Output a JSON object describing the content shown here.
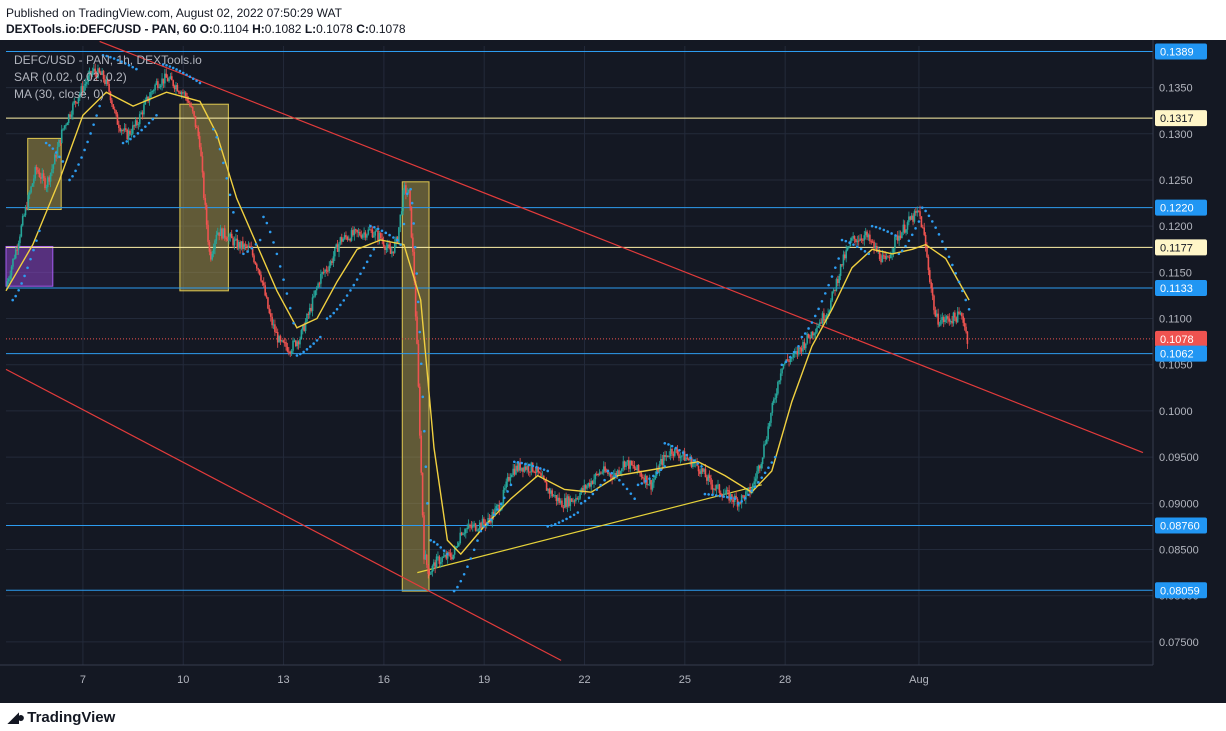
{
  "header": {
    "published": "Published on TradingView.com, August 02, 2022 07:50:29 WAT",
    "symbol": "DEXTools.io:DEFC/USD - PAN, 60",
    "o_label": "O:",
    "o": "0.1104",
    "h_label": "H:",
    "h": "0.1082",
    "l_label": "L:",
    "l": "0.1078",
    "c_label": "C:",
    "c": "0.1078"
  },
  "legend": {
    "title": "DEFC/USD - PAN, 1h, DEXTools.io",
    "sar": "SAR (0.02, 0.02, 0.2)",
    "ma": "MA (30, close, 0)"
  },
  "footer": {
    "logo": "TradingView"
  },
  "colors": {
    "background": "#141823",
    "grid": "#232a3a",
    "axis_text": "#b2b5be",
    "up": "#26a69a",
    "down": "#ef5350",
    "sar": "#2d9cf0",
    "ma": "#f0d040",
    "blue_level": "#2d9cf0",
    "yellow_level": "#fff2a8",
    "trend_red": "#e23b3b",
    "trend_yellow": "#e6d23a"
  },
  "chart_data": {
    "type": "candlestick",
    "ylim": [
      0.0725,
      0.1395
    ],
    "xlim": [
      4.7,
      39.0
    ],
    "y_ticks": [
      "0.07500",
      "0.08000",
      "0.08500",
      "0.09000",
      "0.09500",
      "0.1000",
      "0.1050",
      "0.1100",
      "0.1150",
      "0.1200",
      "0.1250",
      "0.1300",
      "0.1350"
    ],
    "x_ticks": [
      {
        "x": 7,
        "label": "7"
      },
      {
        "x": 10,
        "label": "10"
      },
      {
        "x": 13,
        "label": "13"
      },
      {
        "x": 16,
        "label": "16"
      },
      {
        "x": 19,
        "label": "19"
      },
      {
        "x": 22,
        "label": "22"
      },
      {
        "x": 25,
        "label": "25"
      },
      {
        "x": 28,
        "label": "28"
      },
      {
        "x": 32,
        "label": "Aug"
      }
    ],
    "price_levels": [
      {
        "value": 0.1389,
        "label": "0.1389",
        "style": "blue"
      },
      {
        "value": 0.1317,
        "label": "0.1317",
        "style": "yellow"
      },
      {
        "value": 0.122,
        "label": "0.1220",
        "style": "blue"
      },
      {
        "value": 0.1177,
        "label": "0.1177",
        "style": "yellow"
      },
      {
        "value": 0.1133,
        "label": "0.1133",
        "style": "blue"
      },
      {
        "value": 0.1078,
        "label": "0.1078",
        "style": "last"
      },
      {
        "value": 0.1062,
        "label": "0.1062",
        "style": "blue"
      },
      {
        "value": 0.0876,
        "label": "0.08760",
        "style": "blue"
      },
      {
        "value": 0.08059,
        "label": "0.08059",
        "style": "blue"
      }
    ],
    "price_path": [
      [
        4.7,
        0.1135
      ],
      [
        5.0,
        0.1175
      ],
      [
        5.3,
        0.122
      ],
      [
        5.6,
        0.1262
      ],
      [
        5.9,
        0.1245
      ],
      [
        6.1,
        0.1265
      ],
      [
        6.4,
        0.1305
      ],
      [
        6.7,
        0.133
      ],
      [
        7.0,
        0.135
      ],
      [
        7.3,
        0.1368
      ],
      [
        7.6,
        0.1362
      ],
      [
        7.8,
        0.1345
      ],
      [
        8.0,
        0.1315
      ],
      [
        8.3,
        0.1298
      ],
      [
        8.6,
        0.131
      ],
      [
        8.9,
        0.1335
      ],
      [
        9.2,
        0.1355
      ],
      [
        9.5,
        0.136
      ],
      [
        9.8,
        0.1352
      ],
      [
        10.1,
        0.134
      ],
      [
        10.3,
        0.132
      ],
      [
        10.5,
        0.129
      ],
      [
        10.6,
        0.124
      ],
      [
        10.8,
        0.1165
      ],
      [
        11.0,
        0.1195
      ],
      [
        11.3,
        0.119
      ],
      [
        11.6,
        0.118
      ],
      [
        12.0,
        0.1175
      ],
      [
        12.3,
        0.115
      ],
      [
        12.6,
        0.11
      ],
      [
        12.9,
        0.1072
      ],
      [
        13.2,
        0.1068
      ],
      [
        13.5,
        0.108
      ],
      [
        13.8,
        0.111
      ],
      [
        14.1,
        0.1145
      ],
      [
        14.4,
        0.116
      ],
      [
        14.7,
        0.1185
      ],
      [
        15.0,
        0.119
      ],
      [
        15.3,
        0.1192
      ],
      [
        15.6,
        0.1195
      ],
      [
        15.9,
        0.1188
      ],
      [
        16.2,
        0.117
      ],
      [
        16.4,
        0.1185
      ],
      [
        16.6,
        0.124
      ],
      [
        16.75,
        0.1235
      ],
      [
        16.9,
        0.115
      ],
      [
        17.0,
        0.106
      ],
      [
        17.1,
        0.095
      ],
      [
        17.2,
        0.0845
      ],
      [
        17.35,
        0.0825
      ],
      [
        17.6,
        0.0838
      ],
      [
        17.9,
        0.0842
      ],
      [
        18.1,
        0.0845
      ],
      [
        18.3,
        0.087
      ],
      [
        18.7,
        0.0875
      ],
      [
        19.1,
        0.088
      ],
      [
        19.5,
        0.09
      ],
      [
        19.8,
        0.0935
      ],
      [
        20.1,
        0.094
      ],
      [
        20.5,
        0.0938
      ],
      [
        20.9,
        0.0915
      ],
      [
        21.3,
        0.09
      ],
      [
        21.7,
        0.0905
      ],
      [
        22.1,
        0.092
      ],
      [
        22.5,
        0.0935
      ],
      [
        22.9,
        0.093
      ],
      [
        23.2,
        0.0945
      ],
      [
        23.6,
        0.0935
      ],
      [
        24.0,
        0.092
      ],
      [
        24.3,
        0.0945
      ],
      [
        24.6,
        0.0958
      ],
      [
        25.0,
        0.095
      ],
      [
        25.4,
        0.094
      ],
      [
        25.8,
        0.092
      ],
      [
        26.2,
        0.091
      ],
      [
        26.6,
        0.0902
      ],
      [
        27.0,
        0.0915
      ],
      [
        27.3,
        0.095
      ],
      [
        27.6,
        0.1
      ],
      [
        27.9,
        0.105
      ],
      [
        28.3,
        0.106
      ],
      [
        28.8,
        0.1085
      ],
      [
        29.3,
        0.111
      ],
      [
        29.7,
        0.116
      ],
      [
        30.0,
        0.1185
      ],
      [
        30.4,
        0.119
      ],
      [
        30.7,
        0.1175
      ],
      [
        31.0,
        0.116
      ],
      [
        31.3,
        0.1185
      ],
      [
        31.7,
        0.1205
      ],
      [
        32.0,
        0.1215
      ],
      [
        32.15,
        0.119
      ],
      [
        32.3,
        0.115
      ],
      [
        32.5,
        0.11
      ],
      [
        32.7,
        0.1098
      ],
      [
        33.0,
        0.11
      ],
      [
        33.3,
        0.1104
      ],
      [
        33.45,
        0.1078
      ]
    ],
    "ma_path": [
      [
        4.7,
        0.113
      ],
      [
        5.5,
        0.118
      ],
      [
        6.3,
        0.125
      ],
      [
        7.0,
        0.132
      ],
      [
        7.7,
        0.1345
      ],
      [
        8.5,
        0.133
      ],
      [
        9.5,
        0.1345
      ],
      [
        10.5,
        0.1335
      ],
      [
        11.0,
        0.13
      ],
      [
        11.6,
        0.123
      ],
      [
        12.2,
        0.118
      ],
      [
        12.8,
        0.113
      ],
      [
        13.4,
        0.109
      ],
      [
        14.0,
        0.11
      ],
      [
        14.6,
        0.114
      ],
      [
        15.2,
        0.1175
      ],
      [
        15.9,
        0.1185
      ],
      [
        16.6,
        0.118
      ],
      [
        17.1,
        0.112
      ],
      [
        17.5,
        0.096
      ],
      [
        17.9,
        0.086
      ],
      [
        18.3,
        0.0845
      ],
      [
        19.0,
        0.0875
      ],
      [
        19.8,
        0.0905
      ],
      [
        20.6,
        0.093
      ],
      [
        21.4,
        0.0915
      ],
      [
        22.2,
        0.0912
      ],
      [
        23.0,
        0.093
      ],
      [
        23.8,
        0.0935
      ],
      [
        24.6,
        0.094
      ],
      [
        25.4,
        0.0945
      ],
      [
        26.2,
        0.093
      ],
      [
        27.0,
        0.0912
      ],
      [
        27.6,
        0.0935
      ],
      [
        28.2,
        0.101
      ],
      [
        28.8,
        0.107
      ],
      [
        29.4,
        0.111
      ],
      [
        30.0,
        0.1155
      ],
      [
        30.6,
        0.1175
      ],
      [
        31.2,
        0.117
      ],
      [
        31.8,
        0.1175
      ],
      [
        32.2,
        0.118
      ],
      [
        32.8,
        0.1165
      ],
      [
        33.5,
        0.112
      ]
    ],
    "sar_segments": [
      {
        "from": [
          4.9,
          0.112
        ],
        "to": [
          5.7,
          0.1195
        ],
        "n": 10
      },
      {
        "from": [
          5.9,
          0.129
        ],
        "to": [
          6.4,
          0.127
        ],
        "n": 6
      },
      {
        "from": [
          6.6,
          0.125
        ],
        "to": [
          7.5,
          0.133
        ],
        "n": 11
      },
      {
        "from": [
          7.6,
          0.1385
        ],
        "to": [
          8.6,
          0.137
        ],
        "n": 10
      },
      {
        "from": [
          8.2,
          0.129
        ],
        "to": [
          9.2,
          0.132
        ],
        "n": 10
      },
      {
        "from": [
          9.4,
          0.1375
        ],
        "to": [
          10.5,
          0.1355
        ],
        "n": 12
      },
      {
        "from": [
          10.9,
          0.1305
        ],
        "to": [
          11.6,
          0.1195
        ],
        "n": 8
      },
      {
        "from": [
          11.8,
          0.117
        ],
        "to": [
          12.3,
          0.1185
        ],
        "n": 5
      },
      {
        "from": [
          12.4,
          0.121
        ],
        "to": [
          13.3,
          0.1095
        ],
        "n": 10
      },
      {
        "from": [
          13.4,
          0.106
        ],
        "to": [
          14.1,
          0.108
        ],
        "n": 8
      },
      {
        "from": [
          14.3,
          0.11
        ],
        "to": [
          15.7,
          0.1175
        ],
        "n": 15
      },
      {
        "from": [
          15.6,
          0.12
        ],
        "to": [
          16.4,
          0.1185
        ],
        "n": 8
      },
      {
        "from": [
          16.5,
          0.118
        ],
        "to": [
          16.7,
          0.1235
        ],
        "n": 3
      },
      {
        "from": [
          16.8,
          0.124
        ],
        "to": [
          17.3,
          0.09
        ],
        "n": 12
      },
      {
        "from": [
          17.4,
          0.086
        ],
        "to": [
          17.9,
          0.0845
        ],
        "n": 6
      },
      {
        "from": [
          18.1,
          0.0805
        ],
        "to": [
          18.9,
          0.087
        ],
        "n": 9
      },
      {
        "from": [
          19.0,
          0.0875
        ],
        "to": [
          19.8,
          0.092
        ],
        "n": 9
      },
      {
        "from": [
          19.9,
          0.0945
        ],
        "to": [
          20.9,
          0.0935
        ],
        "n": 10
      },
      {
        "from": [
          20.9,
          0.0875
        ],
        "to": [
          21.8,
          0.089
        ],
        "n": 9
      },
      {
        "from": [
          21.9,
          0.09
        ],
        "to": [
          22.6,
          0.0925
        ],
        "n": 7
      },
      {
        "from": [
          22.7,
          0.0935
        ],
        "to": [
          23.5,
          0.0905
        ],
        "n": 8
      },
      {
        "from": [
          23.6,
          0.092
        ],
        "to": [
          24.4,
          0.094
        ],
        "n": 8
      },
      {
        "from": [
          24.4,
          0.0965
        ],
        "to": [
          25.5,
          0.094
        ],
        "n": 11
      },
      {
        "from": [
          25.6,
          0.091
        ],
        "to": [
          26.5,
          0.0905
        ],
        "n": 9
      },
      {
        "from": [
          26.6,
          0.09
        ],
        "to": [
          27.7,
          0.095
        ],
        "n": 12
      },
      {
        "from": [
          27.9,
          0.105
        ],
        "to": [
          28.4,
          0.107
        ],
        "n": 5
      },
      {
        "from": [
          28.5,
          0.108
        ],
        "to": [
          29.6,
          0.1165
        ],
        "n": 12
      },
      {
        "from": [
          29.7,
          0.1185
        ],
        "to": [
          30.5,
          0.117
        ],
        "n": 8
      },
      {
        "from": [
          30.6,
          0.12
        ],
        "to": [
          31.3,
          0.119
        ],
        "n": 7
      },
      {
        "from": [
          31.4,
          0.117
        ],
        "to": [
          32.0,
          0.1205
        ],
        "n": 7
      },
      {
        "from": [
          32.1,
          0.122
        ],
        "to": [
          33.5,
          0.111
        ],
        "n": 15
      }
    ],
    "trend_lines": [
      {
        "color": "trend_red",
        "from": [
          7.5,
          0.14
        ],
        "to": [
          38.7,
          0.0955
        ]
      },
      {
        "color": "trend_red",
        "from": [
          4.7,
          0.1045
        ],
        "to": [
          21.3,
          0.073
        ]
      },
      {
        "color": "trend_yellow",
        "from": [
          17.0,
          0.0825
        ],
        "to": [
          27.3,
          0.092
        ]
      }
    ],
    "boxes": [
      {
        "color": "yellow",
        "x0": 5.35,
        "x1": 6.35,
        "y0": 0.1295,
        "y1": 0.1218
      },
      {
        "color": "yellow",
        "x0": 9.9,
        "x1": 11.35,
        "y0": 0.1332,
        "y1": 0.113
      },
      {
        "color": "yellow",
        "x0": 16.55,
        "x1": 17.35,
        "y0": 0.1248,
        "y1": 0.0805
      },
      {
        "color": "purple",
        "x0": 4.7,
        "x1": 6.1,
        "y0": 0.1178,
        "y1": 0.1135
      }
    ]
  }
}
